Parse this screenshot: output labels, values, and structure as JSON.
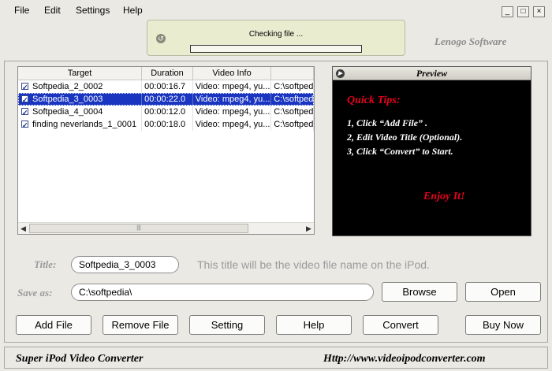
{
  "menu": [
    "File",
    "Edit",
    "Settings",
    "Help"
  ],
  "window_controls": {
    "minimize": "_",
    "maximize": "□",
    "close": "×"
  },
  "progress": {
    "text": "Checking file ...",
    "fraction": 0.0
  },
  "brand": "Lenogo Software",
  "list": {
    "columns": [
      "Target",
      "Duration",
      "Video Info",
      ""
    ],
    "rows": [
      {
        "target": "Softpedia_2_0002",
        "duration": "00:00:16.7",
        "video_info": "Video: mpeg4, yu...",
        "path": "C:\\softped",
        "checked": true,
        "selected": false
      },
      {
        "target": "Softpedia_3_0003",
        "duration": "00:00:22.0",
        "video_info": "Video: mpeg4, yu...",
        "path": "C:\\softped",
        "checked": true,
        "selected": true
      },
      {
        "target": "Softpedia_4_0004",
        "duration": "00:00:12.0",
        "video_info": "Video: mpeg4, yu...",
        "path": "C:\\softped",
        "checked": true,
        "selected": false
      },
      {
        "target": "finding neverlands_1_0001",
        "duration": "00:00:18.0",
        "video_info": "Video: mpeg4, yu...",
        "path": "C:\\softped",
        "checked": true,
        "selected": false
      }
    ]
  },
  "preview": {
    "title": "Preview",
    "quick_tips": "Quick Tips:",
    "tips": [
      "1, Click “Add File” .",
      "2, Edit Video Title (Optional).",
      "3, Click “Convert” to Start."
    ],
    "enjoy": "Enjoy It!"
  },
  "title_row": {
    "label": "Title:",
    "value": "Softpedia_3_0003",
    "hint": "This title will be the video file name on the iPod."
  },
  "save_row": {
    "label": "Save as:",
    "value": "C:\\softpedia\\"
  },
  "buttons": {
    "browse": "Browse",
    "open": "Open",
    "add_file": "Add File",
    "remove_file": "Remove File",
    "setting": "Setting",
    "help": "Help",
    "convert": "Convert",
    "buy_now": "Buy Now"
  },
  "footer": {
    "app_name": "Super iPod Video Converter",
    "url": "Http://www.videoipodconverter.com"
  },
  "colors": {
    "selection": "#1a35c0",
    "tips_red": "#e8001c",
    "tips_white": "#ffffff"
  }
}
